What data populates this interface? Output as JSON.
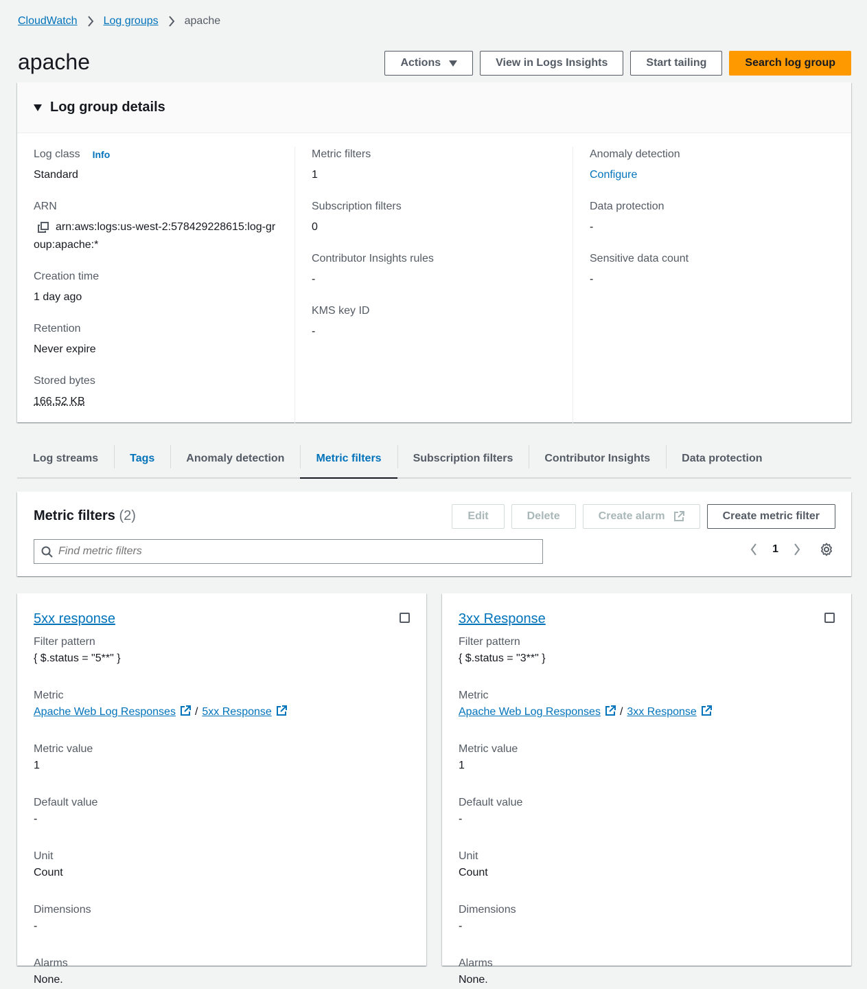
{
  "breadcrumb": {
    "items": [
      "CloudWatch",
      "Log groups"
    ],
    "current": "apache"
  },
  "page_title": "apache",
  "header_actions": {
    "actions": "Actions",
    "insights": "View in Logs Insights",
    "tailing": "Start tailing",
    "search": "Search log group"
  },
  "details": {
    "heading": "Log group details",
    "info_label": "Info",
    "col1": [
      {
        "k": "Log class",
        "v": "Standard"
      },
      {
        "k": "ARN",
        "v": "arn:aws:logs:us-west-2:578429228615:log-group:apache:*"
      },
      {
        "k": "Creation time",
        "v": "1 day ago"
      },
      {
        "k": "Retention",
        "v": "Never expire"
      },
      {
        "k": "Stored bytes",
        "v": "166.52 KB"
      }
    ],
    "col2": [
      {
        "k": "Metric filters",
        "v": "1"
      },
      {
        "k": "Subscription filters",
        "v": "0"
      },
      {
        "k": "Contributor Insights rules",
        "v": "-"
      },
      {
        "k": "KMS key ID",
        "v": "-"
      }
    ],
    "col3": [
      {
        "k": "Anomaly detection",
        "v": "Configure"
      },
      {
        "k": "Data protection",
        "v": "-"
      },
      {
        "k": "Sensitive data count",
        "v": "-"
      }
    ]
  },
  "tabs": [
    "Log streams",
    "Tags",
    "Anomaly detection",
    "Metric filters",
    "Subscription filters",
    "Contributor Insights",
    "Data protection"
  ],
  "metric_filters": {
    "title": "Metric filters",
    "count": "(2)",
    "edit": "Edit",
    "delete": "Delete",
    "create_alarm": "Create alarm",
    "create": "Create metric filter",
    "search_placeholder": "Find metric filters",
    "page": "1"
  },
  "labels": {
    "filter_pattern": "Filter pattern",
    "metric": "Metric",
    "metric_value": "Metric value",
    "default_value": "Default value",
    "unit": "Unit",
    "dimensions": "Dimensions",
    "alarms": "Alarms",
    "slash": "/"
  },
  "filters": [
    {
      "name": "5xx response",
      "pattern": "{ $.status = \"5**\" }",
      "namespace": "Apache Web Log Responses",
      "metric": "5xx Response",
      "metric_value": "1",
      "default_value": "-",
      "unit": "Count",
      "dimensions": "-",
      "alarms": "None."
    },
    {
      "name": "3xx Response",
      "pattern": "{ $.status = \"3**\" }",
      "namespace": "Apache Web Log Responses",
      "metric": "3xx Response",
      "metric_value": "1",
      "default_value": "-",
      "unit": "Count",
      "dimensions": "-",
      "alarms": "None."
    }
  ],
  "colors": {
    "link": "#0073bb",
    "primary": "#ff9900",
    "bg": "#f2f3f3"
  }
}
